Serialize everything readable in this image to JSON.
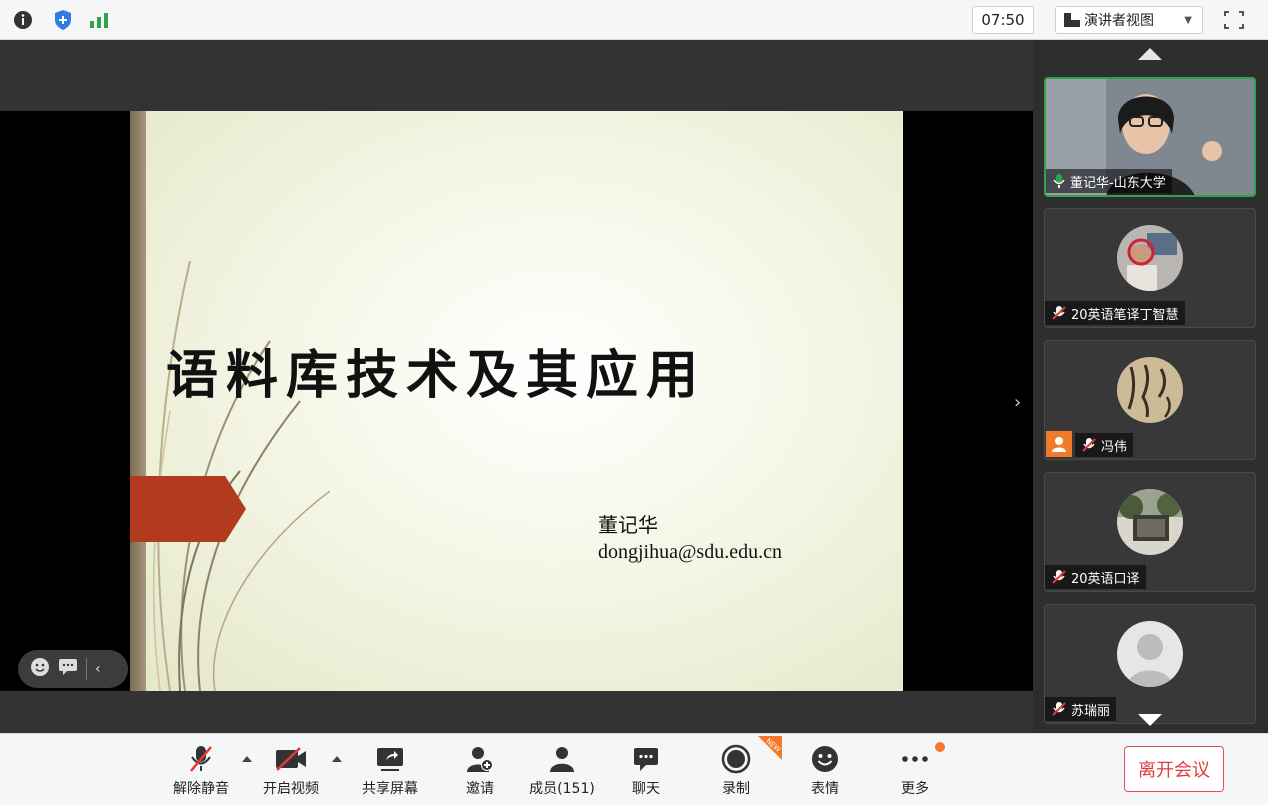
{
  "topbar": {
    "timer": "07:50",
    "view_mode": "演讲者视图",
    "icons": [
      "info-icon",
      "security-shield-icon",
      "signal-strength-icon",
      "fullscreen-icon"
    ]
  },
  "slide": {
    "title": "语料库技术及其应用",
    "author": "董记华",
    "email": "dongjihua@sdu.edu.cn"
  },
  "participants": [
    {
      "name": "董记华-山东大学",
      "muted": false,
      "speaking": true
    },
    {
      "name": "20英语笔译丁智慧",
      "muted": true
    },
    {
      "name": "冯伟",
      "muted": true,
      "host": true
    },
    {
      "name": "20英语口译",
      "muted": true
    },
    {
      "name": "苏瑞丽",
      "muted": true
    }
  ],
  "toolbar": {
    "unmute": "解除静音",
    "start_video": "开启视频",
    "share_screen": "共享屏幕",
    "invite": "邀请",
    "members": "成员(151)",
    "chat": "聊天",
    "record": "录制",
    "reactions": "表情",
    "more": "更多",
    "leave": "离开会议",
    "new_badge": "NEW"
  },
  "colors": {
    "accent_green": "#2fa34a",
    "leave_red": "#e03b3b",
    "slide_arrow": "#b23a1e",
    "host_orange": "#f07b2a"
  }
}
